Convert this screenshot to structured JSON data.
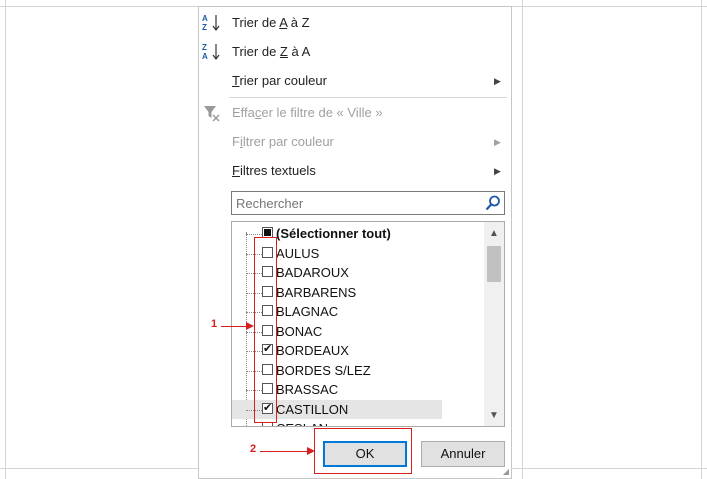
{
  "menu": {
    "sort_az": {
      "prefix": "Trier de ",
      "accel": "A",
      "suffix": " à Z"
    },
    "sort_za": {
      "prefix": "Trier de ",
      "accel": "Z",
      "suffix": " à A"
    },
    "sort_color": {
      "accel": "T",
      "rest": "rier par couleur"
    },
    "clear_filter": {
      "prefix": "Effa",
      "accel": "c",
      "rest": "er le filtre de « Ville »"
    },
    "filter_color": {
      "prefix": "F",
      "accel": "i",
      "rest": "ltrer par couleur"
    },
    "text_filters": {
      "accel": "F",
      "rest": "iltres textuels"
    }
  },
  "search": {
    "placeholder": "Rechercher"
  },
  "list": {
    "items": [
      {
        "label": "(Sélectionner tout)",
        "state": "partial"
      },
      {
        "label": "AULUS",
        "state": "unchecked"
      },
      {
        "label": "BADAROUX",
        "state": "unchecked"
      },
      {
        "label": "BARBARENS",
        "state": "unchecked"
      },
      {
        "label": "BLAGNAC",
        "state": "unchecked"
      },
      {
        "label": "BONAC",
        "state": "unchecked"
      },
      {
        "label": "BORDEAUX",
        "state": "checked"
      },
      {
        "label": "BORDES S/LEZ",
        "state": "unchecked"
      },
      {
        "label": "BRASSAC",
        "state": "unchecked"
      },
      {
        "label": "CASTILLON",
        "state": "checked"
      },
      {
        "label": "CESLAN",
        "state": "unchecked"
      }
    ]
  },
  "buttons": {
    "ok": "OK",
    "cancel": "Annuler"
  },
  "annotations": {
    "one": "1",
    "two": "2"
  },
  "colors": {
    "accent": "#0078d7",
    "annotation": "#d62020"
  }
}
